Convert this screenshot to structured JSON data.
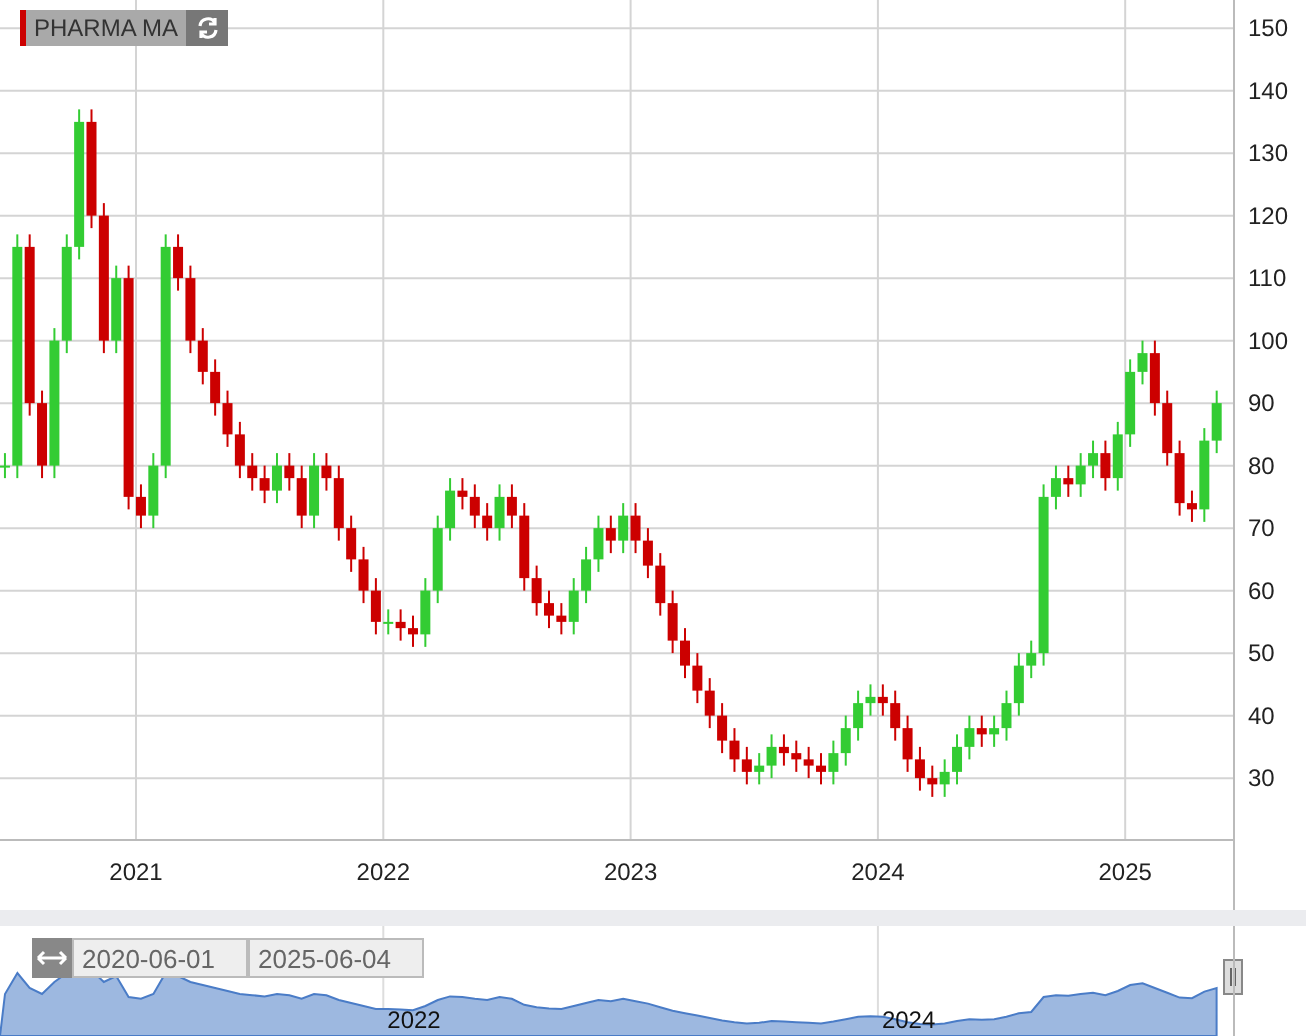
{
  "main_chart": {
    "chart_data": {
      "type": "candlestick",
      "title": "PHARMA MA",
      "grid": true,
      "xlim": [
        2020.45,
        2025.44
      ],
      "ylim": [
        20.1,
        154.5
      ],
      "xticks": [
        {
          "value": 2021,
          "label": "2021"
        },
        {
          "value": 2022,
          "label": "2022"
        },
        {
          "value": 2023,
          "label": "2023"
        },
        {
          "value": 2024,
          "label": "2024"
        },
        {
          "value": 2025,
          "label": "2025"
        }
      ],
      "yticks": [
        30,
        40,
        50,
        60,
        70,
        80,
        90,
        100,
        110,
        120,
        130,
        140,
        150
      ],
      "x": [
        2020.47,
        2020.52,
        2020.57,
        2020.62,
        2020.67,
        2020.72,
        2020.77,
        2020.82,
        2020.87,
        2020.92,
        2020.97,
        2021.02,
        2021.07,
        2021.12,
        2021.17,
        2021.22,
        2021.27,
        2021.32,
        2021.37,
        2021.42,
        2021.47,
        2021.52,
        2021.57,
        2021.62,
        2021.67,
        2021.72,
        2021.77,
        2021.82,
        2021.87,
        2021.92,
        2021.97,
        2022.02,
        2022.07,
        2022.12,
        2022.17,
        2022.22,
        2022.27,
        2022.32,
        2022.37,
        2022.42,
        2022.47,
        2022.52,
        2022.57,
        2022.62,
        2022.67,
        2022.72,
        2022.77,
        2022.82,
        2022.87,
        2022.92,
        2022.97,
        2023.02,
        2023.07,
        2023.12,
        2023.17,
        2023.22,
        2023.27,
        2023.32,
        2023.37,
        2023.42,
        2023.47,
        2023.52,
        2023.57,
        2023.62,
        2023.67,
        2023.72,
        2023.77,
        2023.82,
        2023.87,
        2023.92,
        2023.97,
        2024.02,
        2024.07,
        2024.12,
        2024.17,
        2024.22,
        2024.27,
        2024.32,
        2024.37,
        2024.42,
        2024.47,
        2024.52,
        2024.57,
        2024.62,
        2024.67,
        2024.72,
        2024.77,
        2024.82,
        2024.87,
        2024.92,
        2024.97,
        2025.02,
        2025.07,
        2025.12,
        2025.17,
        2025.22,
        2025.27,
        2025.32,
        2025.37
      ],
      "ohlc": [
        [
          80,
          82,
          78,
          80
        ],
        [
          80,
          117,
          78,
          115
        ],
        [
          115,
          117,
          88,
          90
        ],
        [
          90,
          92,
          78,
          80
        ],
        [
          80,
          102,
          78,
          100
        ],
        [
          100,
          117,
          98,
          115
        ],
        [
          115,
          137,
          113,
          135
        ],
        [
          135,
          137,
          118,
          120
        ],
        [
          120,
          122,
          98,
          100
        ],
        [
          100,
          112,
          98,
          110
        ],
        [
          110,
          112,
          73,
          75
        ],
        [
          75,
          77,
          70,
          72
        ],
        [
          72,
          82,
          70,
          80
        ],
        [
          80,
          117,
          78,
          115
        ],
        [
          115,
          117,
          108,
          110
        ],
        [
          110,
          112,
          98,
          100
        ],
        [
          100,
          102,
          93,
          95
        ],
        [
          95,
          97,
          88,
          90
        ],
        [
          90,
          92,
          83,
          85
        ],
        [
          85,
          87,
          78,
          80
        ],
        [
          80,
          82,
          76,
          78
        ],
        [
          78,
          80,
          74,
          76
        ],
        [
          76,
          82,
          74,
          80
        ],
        [
          80,
          82,
          76,
          78
        ],
        [
          78,
          80,
          70,
          72
        ],
        [
          72,
          82,
          70,
          80
        ],
        [
          80,
          82,
          76,
          78
        ],
        [
          78,
          80,
          68,
          70
        ],
        [
          70,
          72,
          63,
          65
        ],
        [
          65,
          67,
          58,
          60
        ],
        [
          60,
          62,
          53,
          55
        ],
        [
          55,
          57,
          53,
          55
        ],
        [
          55,
          57,
          52,
          54
        ],
        [
          54,
          56,
          51,
          53
        ],
        [
          53,
          62,
          51,
          60
        ],
        [
          60,
          72,
          58,
          70
        ],
        [
          70,
          78,
          68,
          76
        ],
        [
          76,
          78,
          73,
          75
        ],
        [
          75,
          77,
          70,
          72
        ],
        [
          72,
          74,
          68,
          70
        ],
        [
          70,
          77,
          68,
          75
        ],
        [
          75,
          77,
          70,
          72
        ],
        [
          72,
          74,
          60,
          62
        ],
        [
          62,
          64,
          56,
          58
        ],
        [
          58,
          60,
          54,
          56
        ],
        [
          56,
          58,
          53,
          55
        ],
        [
          55,
          62,
          53,
          60
        ],
        [
          60,
          67,
          58,
          65
        ],
        [
          65,
          72,
          63,
          70
        ],
        [
          70,
          72,
          66,
          68
        ],
        [
          68,
          74,
          66,
          72
        ],
        [
          72,
          74,
          66,
          68
        ],
        [
          68,
          70,
          62,
          64
        ],
        [
          64,
          66,
          56,
          58
        ],
        [
          58,
          60,
          50,
          52
        ],
        [
          52,
          54,
          46,
          48
        ],
        [
          48,
          50,
          42,
          44
        ],
        [
          44,
          46,
          38,
          40
        ],
        [
          40,
          42,
          34,
          36
        ],
        [
          36,
          38,
          31,
          33
        ],
        [
          33,
          35,
          29,
          31
        ],
        [
          31,
          34,
          29,
          32
        ],
        [
          32,
          37,
          30,
          35
        ],
        [
          35,
          37,
          32,
          34
        ],
        [
          34,
          36,
          31,
          33
        ],
        [
          33,
          35,
          30,
          32
        ],
        [
          32,
          34,
          29,
          31
        ],
        [
          31,
          36,
          29,
          34
        ],
        [
          34,
          40,
          32,
          38
        ],
        [
          38,
          44,
          36,
          42
        ],
        [
          42,
          45,
          40,
          43
        ],
        [
          43,
          45,
          40,
          42
        ],
        [
          42,
          44,
          36,
          38
        ],
        [
          38,
          40,
          31,
          33
        ],
        [
          33,
          35,
          28,
          30
        ],
        [
          30,
          32,
          27,
          29
        ],
        [
          29,
          33,
          27,
          31
        ],
        [
          31,
          37,
          29,
          35
        ],
        [
          35,
          40,
          33,
          38
        ],
        [
          38,
          40,
          35,
          37
        ],
        [
          37,
          40,
          35,
          38
        ],
        [
          38,
          44,
          36,
          42
        ],
        [
          42,
          50,
          40,
          48
        ],
        [
          48,
          52,
          46,
          50
        ],
        [
          50,
          77,
          48,
          75
        ],
        [
          75,
          80,
          73,
          78
        ],
        [
          78,
          80,
          75,
          77
        ],
        [
          77,
          82,
          75,
          80
        ],
        [
          80,
          84,
          78,
          82
        ],
        [
          82,
          84,
          76,
          78
        ],
        [
          78,
          87,
          76,
          85
        ],
        [
          85,
          97,
          83,
          95
        ],
        [
          95,
          100,
          93,
          98
        ],
        [
          98,
          100,
          88,
          90
        ],
        [
          90,
          92,
          80,
          82
        ],
        [
          82,
          84,
          72,
          74
        ],
        [
          74,
          76,
          71,
          73
        ],
        [
          73,
          86,
          71,
          84
        ],
        [
          84,
          92,
          82,
          90
        ]
      ]
    }
  },
  "navigator": {
    "from": "2020-06-01",
    "to": "2025-06-04",
    "year_labels": [
      "2022",
      "2024"
    ]
  }
}
